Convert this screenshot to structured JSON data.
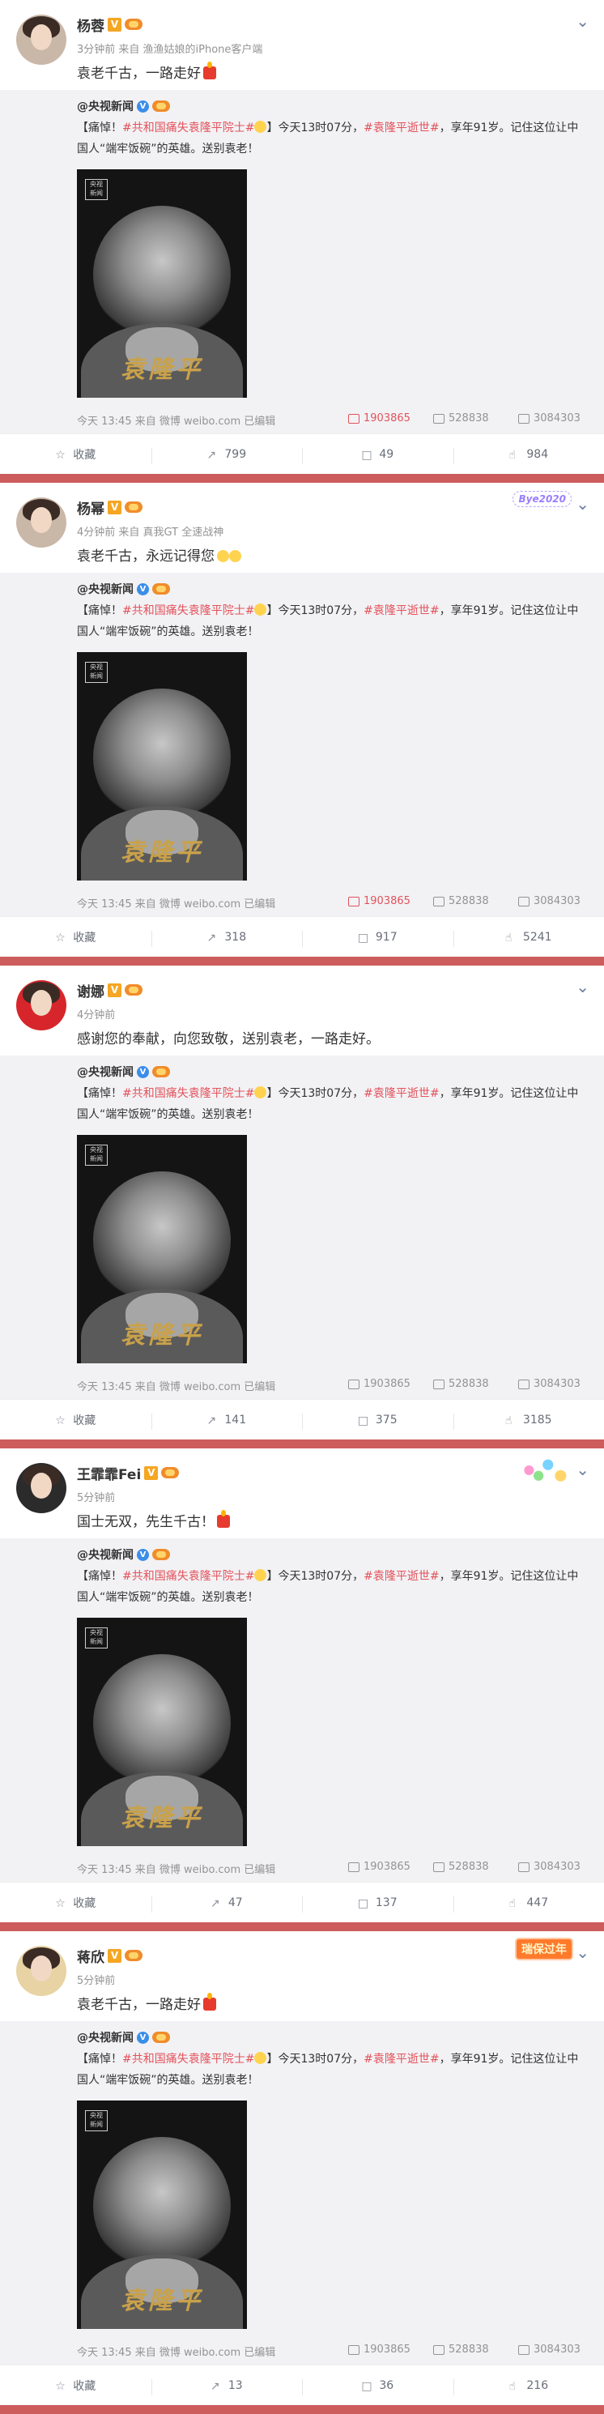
{
  "common": {
    "repost_author": "@央视新闻",
    "repost_text_prefix": "【痛悼！",
    "repost_link1": "#共和国痛失袁隆平院士#",
    "repost_text_mid": "】今天13时07分，",
    "repost_link2": "#袁隆平逝世#",
    "repost_text_suffix": "，享年91岁。记住这位让中国人“端牢饭碗”的英雄。送别袁老！",
    "photo_seal": "央视 新闻",
    "photo_calligraphy": "袁隆平",
    "repost_meta": "今天 13:45 来自 微博 weibo.com  已编辑",
    "repost_reposts": "1903865",
    "repost_comments": "528838",
    "repost_likes": "3084303",
    "action_collect": "收藏"
  },
  "posts": [
    {
      "name": "杨蓉",
      "meta": "3分钟前 来自 渔渔姑娘的iPhone客户端",
      "text": "袁老千古，一路走好",
      "reposts": "799",
      "comments": "49",
      "likes": "984",
      "deco": ""
    },
    {
      "name": "杨幂",
      "meta": "4分钟前 来自 真我GT 全速战神",
      "text": "袁老千古，永远记得您",
      "reposts": "318",
      "comments": "917",
      "likes": "5241",
      "deco": "Bye2020"
    },
    {
      "name": "谢娜",
      "meta": "4分钟前",
      "text": "感谢您的奉献，向您致敬，送别袁老，一路走好。",
      "reposts": "141",
      "comments": "375",
      "likes": "3185",
      "deco": ""
    },
    {
      "name": "王霏霏Fei",
      "meta": "5分钟前",
      "text": "国士无双，先生千古！",
      "reposts": "47",
      "comments": "137",
      "likes": "447",
      "deco": ""
    },
    {
      "name": "蒋欣",
      "meta": "5分钟前",
      "text": "袁老千古，一路走好",
      "reposts": "13",
      "comments": "36",
      "likes": "216",
      "deco": "瑞保过年"
    }
  ]
}
